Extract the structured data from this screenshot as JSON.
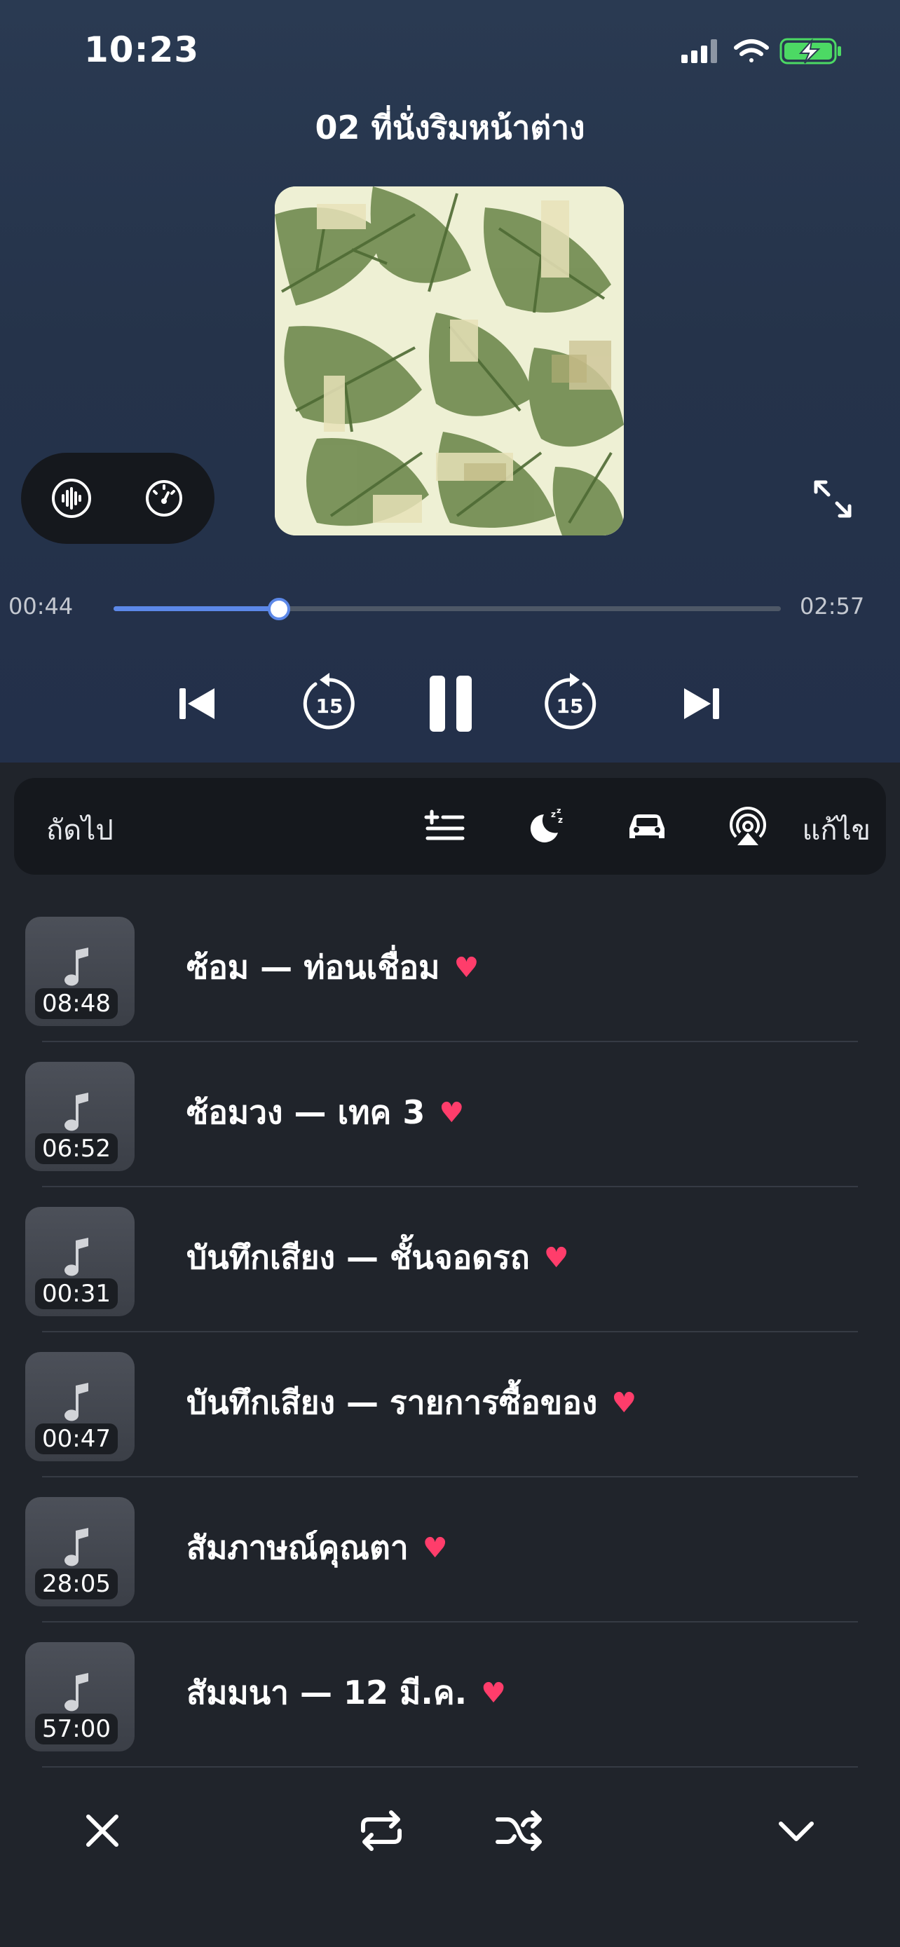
{
  "status": {
    "time": "10:23"
  },
  "player": {
    "title": "02 ที่นั่งริมหน้าต่าง",
    "elapsed": "00:44",
    "total": "02:57",
    "progress": 0.248,
    "skip_back_seconds": "15",
    "skip_forward_seconds": "15"
  },
  "toolbar": {
    "next_label": "ถัดไป",
    "edit_label": "แก้ไข"
  },
  "queue": [
    {
      "title": "ซ้อม — ท่อนเชื่อม",
      "duration": "08:48",
      "favorite": true
    },
    {
      "title": "ซ้อมวง — เทค 3",
      "duration": "06:52",
      "favorite": true
    },
    {
      "title": "บันทึกเสียง — ชั้นจอดรถ",
      "duration": "00:31",
      "favorite": true
    },
    {
      "title": "บันทึกเสียง — รายการซื้อของ",
      "duration": "00:47",
      "favorite": true
    },
    {
      "title": "สัมภาษณ์คุณตา",
      "duration": "28:05",
      "favorite": true
    },
    {
      "title": "สัมมนา — 12 มี.ค.",
      "duration": "57:00",
      "favorite": true
    }
  ],
  "colors": {
    "accent": "#5c88e8",
    "heart": "#ff3d6b",
    "battery": "#4cd964"
  },
  "icons": {
    "waveform": "waveform-icon",
    "speed": "speed-icon",
    "expand": "expand-icon",
    "previous": "previous-track-icon",
    "rewind": "rewind-15-icon",
    "pause": "pause-icon",
    "forward": "forward-15-icon",
    "next": "next-track-icon",
    "add_to_queue": "add-to-queue-icon",
    "sleep": "sleep-timer-icon",
    "car": "car-mode-icon",
    "airplay": "airplay-icon",
    "close": "close-icon",
    "repeat": "repeat-icon",
    "shuffle": "shuffle-icon",
    "collapse": "chevron-down-icon"
  }
}
